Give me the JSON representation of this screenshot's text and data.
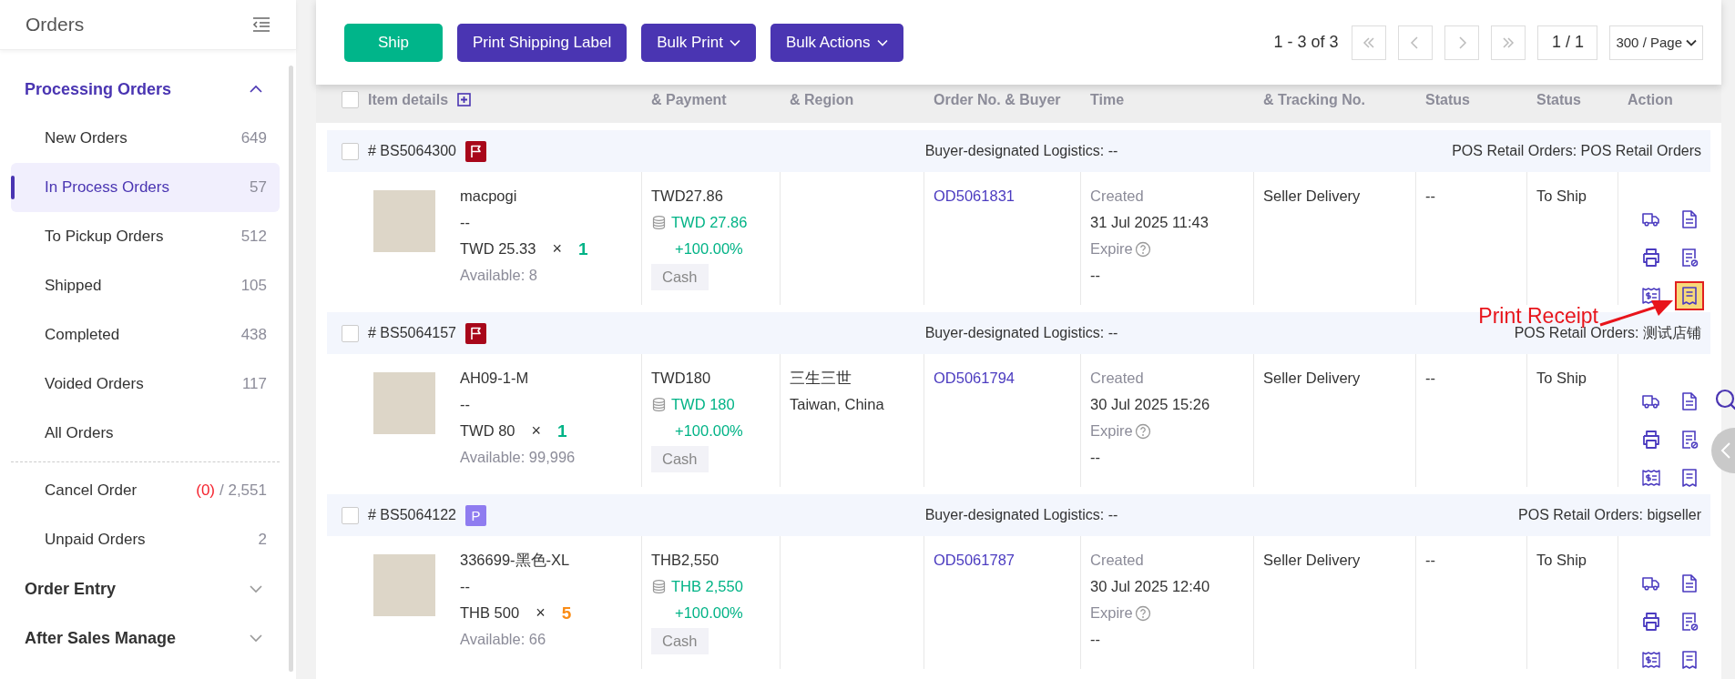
{
  "sidebar": {
    "title": "Orders",
    "sections": [
      {
        "label": "Processing Orders",
        "selected": true,
        "expanded": true,
        "groups": [
          [
            {
              "label": "New Orders",
              "count": "649",
              "selected": false
            },
            {
              "label": "In Process Orders",
              "count": "57",
              "selected": true
            },
            {
              "label": "To Pickup Orders",
              "count": "512",
              "selected": false
            },
            {
              "label": "Shipped",
              "count": "105",
              "selected": false
            },
            {
              "label": "Completed",
              "count": "438",
              "selected": false
            },
            {
              "label": "Voided Orders",
              "count": "117",
              "selected": false
            },
            {
              "label": "All Orders",
              "selected": false
            }
          ],
          [
            {
              "label": "Cancel Order",
              "alert": "(0)",
              "count": "/ 2,551",
              "selected": false
            },
            {
              "label": "Unpaid Orders",
              "count": "2",
              "selected": false
            }
          ]
        ]
      },
      {
        "label": "Order Entry",
        "selected": false,
        "expanded": false
      },
      {
        "label": "After Sales Manage",
        "selected": false,
        "expanded": false
      }
    ]
  },
  "toolbar": {
    "buttons": [
      {
        "label": "Ship",
        "kind": "confirm"
      },
      {
        "label": "Print Shipping Label",
        "kind": "action"
      },
      {
        "label": "Bulk Print",
        "kind": "menu"
      },
      {
        "label": "Bulk Actions",
        "kind": "menu"
      }
    ],
    "pagination": {
      "range": "1 - 3 of 3",
      "page": "1 / 1",
      "page_size": "300 / Page"
    }
  },
  "table": {
    "columns": [
      {
        "label": "Item details"
      },
      {
        "label": "& Payment"
      },
      {
        "label": "& Region"
      },
      {
        "label": "Order No. & Buyer"
      },
      {
        "label": "Time"
      },
      {
        "label": "& Tracking No."
      },
      {
        "label": "Status"
      },
      {
        "label": "Status"
      },
      {
        "label": "Action"
      }
    ],
    "select_all": false,
    "orders": [
      {
        "id": "# BS5064300",
        "badge": {
          "kind": "flag"
        },
        "logistics": "Buyer-designated Logistics: --",
        "store": "POS Retail Orders: POS Retail Orders",
        "selected": false,
        "item": {
          "name": "macpogi",
          "variant": "--",
          "price": "TWD 25.33",
          "times": "×",
          "quantity": {
            "text": "1",
            "color": "#00b386"
          },
          "available": "Available: 8"
        },
        "value": {
          "total": "TWD27.86",
          "paid": "TWD 27.86",
          "percent": "+100.00%",
          "payment": "Cash"
        },
        "order_no": "OD5061831",
        "time": {
          "label": "Created",
          "date": "31 Jul 2025 11:43",
          "expire": "Expire",
          "expire_value": "--"
        },
        "shipping": "Seller Delivery",
        "marketplace_status": "--",
        "status": "To Ship",
        "actions": [
          {
            "kind": "ship",
            "highlighted": false
          },
          {
            "kind": "invoice",
            "highlighted": false
          },
          {
            "kind": "print",
            "highlighted": false
          },
          {
            "kind": "audit",
            "highlighted": false
          },
          {
            "kind": "bill",
            "highlighted": false
          },
          {
            "kind": "receipt",
            "highlighted": true
          }
        ]
      },
      {
        "id": "# BS5064157",
        "badge": {
          "kind": "flag"
        },
        "logistics": "Buyer-designated Logistics: --",
        "store": "POS Retail Orders: 测试店铺",
        "selected": false,
        "item": {
          "name": "AH09-1-M",
          "variant": "--",
          "price": "TWD 80",
          "times": "×",
          "quantity": {
            "text": "1",
            "color": "#00b386"
          },
          "available": "Available: 99,996"
        },
        "value": {
          "total": "TWD180",
          "paid": "TWD 180",
          "percent": "+100.00%",
          "payment": "Cash"
        },
        "recipient": {
          "name": "三生三世",
          "region": "Taiwan, China"
        },
        "order_no": "OD5061794",
        "time": {
          "label": "Created",
          "date": "30 Jul 2025 15:26",
          "expire": "Expire",
          "expire_value": "--"
        },
        "shipping": "Seller Delivery",
        "marketplace_status": "--",
        "status": "To Ship",
        "actions": [
          {
            "kind": "ship",
            "highlighted": false
          },
          {
            "kind": "invoice",
            "highlighted": false
          },
          {
            "kind": "print",
            "highlighted": false
          },
          {
            "kind": "audit",
            "highlighted": false
          },
          {
            "kind": "bill",
            "highlighted": false
          },
          {
            "kind": "receipt",
            "highlighted": false
          }
        ]
      },
      {
        "id": "# BS5064122",
        "badge": {
          "kind": "letter",
          "text": "P"
        },
        "logistics": "Buyer-designated Logistics: --",
        "store": "POS Retail Orders: bigseller",
        "selected": false,
        "item": {
          "name": "336699-黑色-XL",
          "variant": "--",
          "price": "THB 500",
          "times": "×",
          "quantity": {
            "text": "5",
            "color": "#fa8c16"
          },
          "available": "Available: 66"
        },
        "value": {
          "total": "THB2,550",
          "paid": "THB 2,550",
          "percent": "+100.00%",
          "payment": "Cash"
        },
        "order_no": "OD5061787",
        "time": {
          "label": "Created",
          "date": "30 Jul 2025 12:40",
          "expire": "Expire",
          "expire_value": "--"
        },
        "shipping": "Seller Delivery",
        "marketplace_status": "--",
        "status": "To Ship",
        "actions": [
          {
            "kind": "ship",
            "highlighted": false
          },
          {
            "kind": "invoice",
            "highlighted": false
          },
          {
            "kind": "print",
            "highlighted": false
          },
          {
            "kind": "audit",
            "highlighted": false
          },
          {
            "kind": "bill",
            "highlighted": false
          },
          {
            "kind": "receipt",
            "highlighted": false
          }
        ]
      }
    ]
  },
  "annotation": {
    "text": "Print Receipt"
  }
}
